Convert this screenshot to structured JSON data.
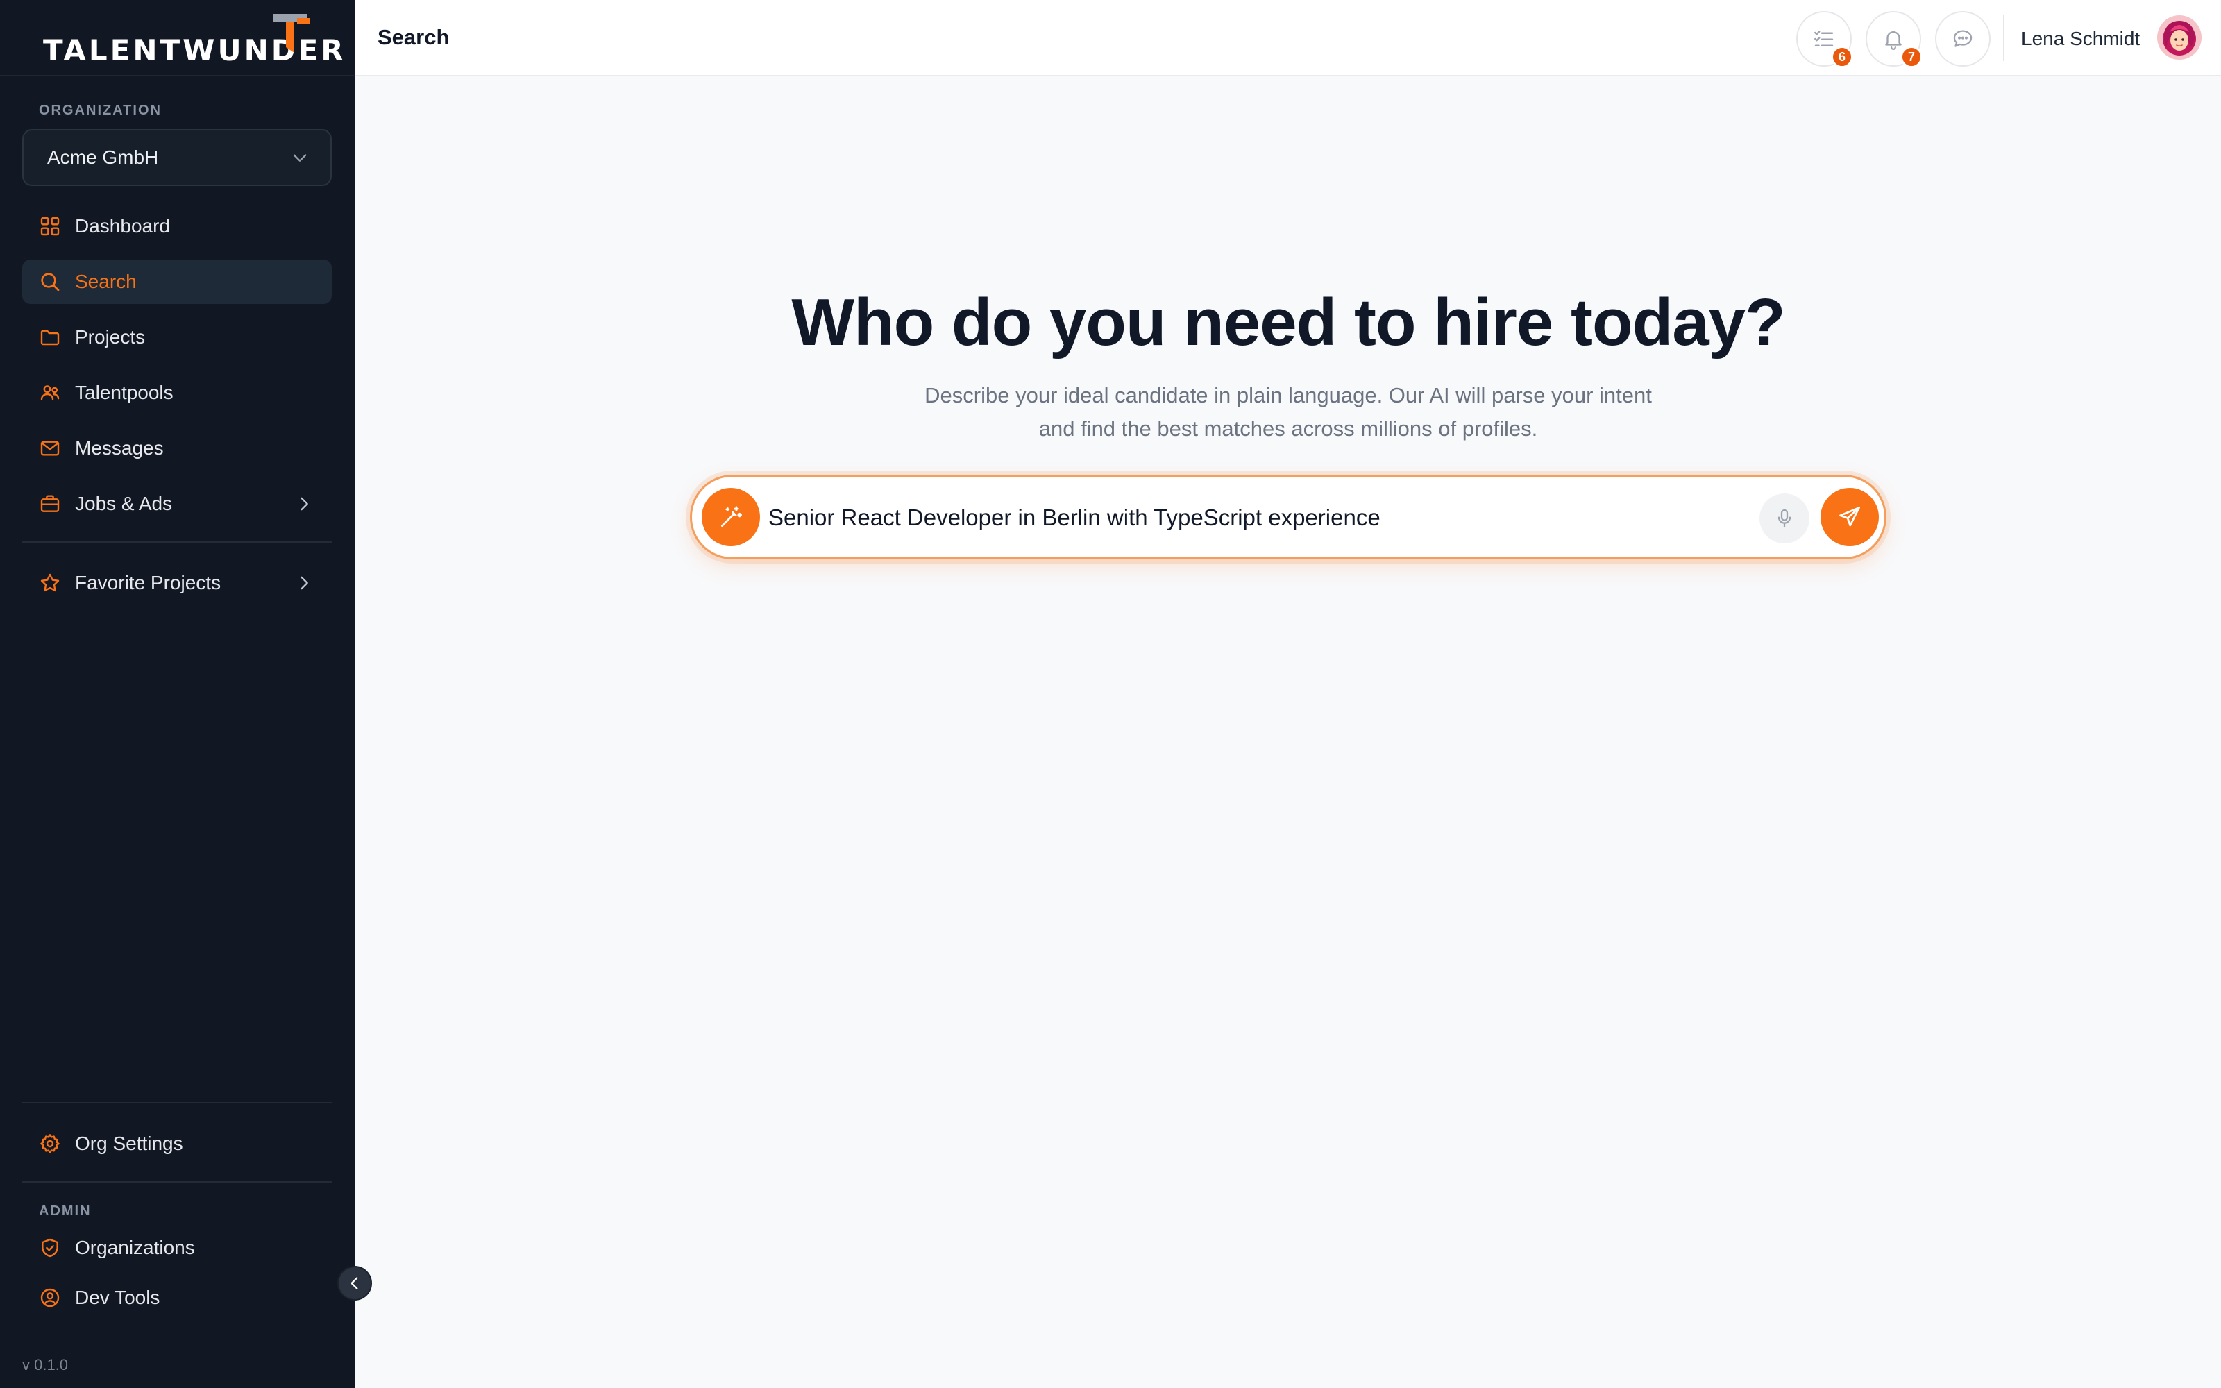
{
  "brand": {
    "name": "TALENTWUNDER"
  },
  "sidebar": {
    "organization_label": "ORGANIZATION",
    "organization_value": "Acme GmbH",
    "items": [
      {
        "label": "Dashboard",
        "icon": "dashboard-icon"
      },
      {
        "label": "Search",
        "icon": "search-icon",
        "active": true
      },
      {
        "label": "Projects",
        "icon": "folder-icon"
      },
      {
        "label": "Talentpools",
        "icon": "users-icon"
      },
      {
        "label": "Messages",
        "icon": "mail-icon"
      },
      {
        "label": "Jobs & Ads",
        "icon": "briefcase-icon",
        "expandable": true
      }
    ],
    "favorites": {
      "label": "Favorite Projects",
      "icon": "star-icon"
    },
    "settings": {
      "label": "Org Settings",
      "icon": "gear-icon"
    },
    "admin_label": "ADMIN",
    "admin_items": [
      {
        "label": "Organizations",
        "icon": "shield-icon"
      },
      {
        "label": "Dev Tools",
        "icon": "user-circle-icon"
      }
    ],
    "version": "v 0.1.0"
  },
  "header": {
    "title": "Search",
    "tasks_badge": "6",
    "notifications_badge": "7",
    "user_name": "Lena Schmidt"
  },
  "main": {
    "headline": "Who do you need to hire today?",
    "subtext": "Describe your ideal candidate in plain language. Our AI will parse your intent and find the best matches across millions of profiles.",
    "search_value": "Senior React Developer in Berlin with TypeScript experience"
  },
  "colors": {
    "accent": "#f97316",
    "sidebar_bg": "#111823",
    "badge": "#ea580c"
  }
}
